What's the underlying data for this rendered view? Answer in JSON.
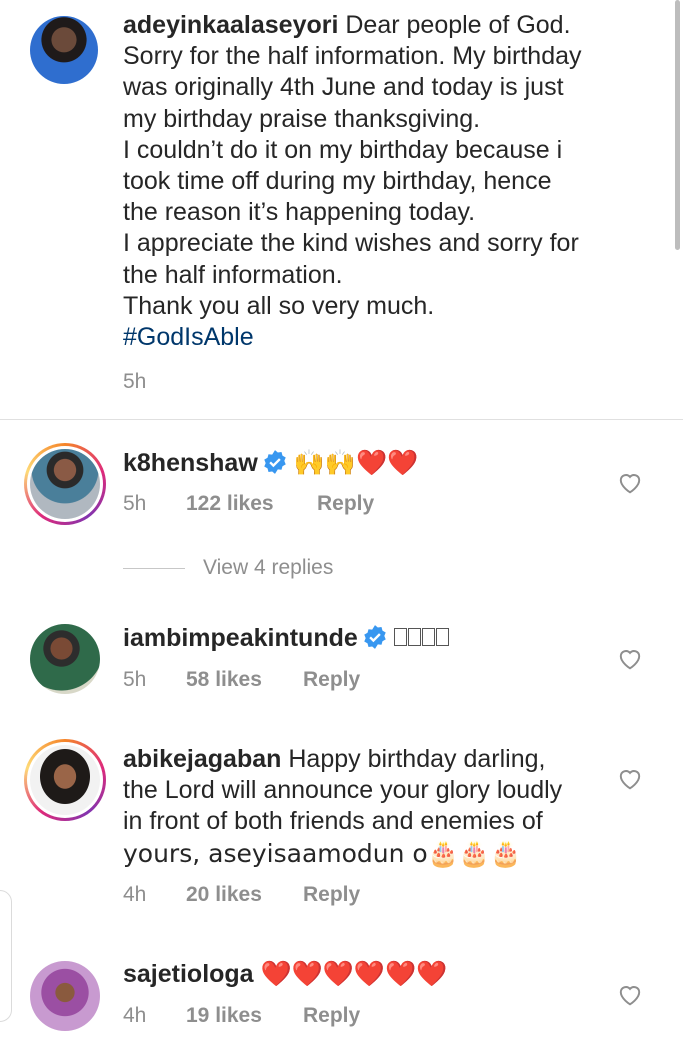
{
  "caption": {
    "username": "adeyinkaalaseyori",
    "lines": [
      "Dear people of God.",
      "Sorry for the half information. My birthday",
      "was originally 4th June and today is just",
      "my birthday praise thanksgiving.",
      "I couldn’t do it on my birthday because i",
      "took time off during my birthday, hence",
      "the reason it’s happening today.",
      "I appreciate the kind wishes and sorry for",
      "the half information.",
      "Thank you all so very much."
    ],
    "hashtag": "#GodIsAble",
    "time": "5h"
  },
  "comments": [
    {
      "username": "k8henshaw",
      "verified": true,
      "text": "🙌🙌❤️❤️",
      "time": "5h",
      "likes": "122 likes",
      "reply": "Reply",
      "view_replies": "View 4 replies"
    },
    {
      "username": "iambimpeakintunde",
      "verified": true,
      "text": "",
      "time": "5h",
      "likes": "58 likes",
      "reply": "Reply"
    },
    {
      "username": "abikejagaban",
      "verified": false,
      "text_lines": [
        "Happy birthday darling,",
        "the Lord will announce your glory loudly",
        "in front of both friends and enemies of",
        "yours, aseyisaamodun o🎂🎂🎂"
      ],
      "time": "4h",
      "likes": "20 likes",
      "reply": "Reply"
    },
    {
      "username": "sajetiologa",
      "verified": false,
      "text": "❤️❤️❤️❤️❤️❤️",
      "time": "4h",
      "likes": "19 likes",
      "reply": "Reply"
    }
  ],
  "colors": {
    "text": "#262626",
    "secondary": "#8e8e8e",
    "hashtag": "#00376b",
    "verified": "#3897f0",
    "heart": "#e0245e"
  },
  "icons": [
    "verified-badge-icon",
    "heart-outline-icon"
  ]
}
